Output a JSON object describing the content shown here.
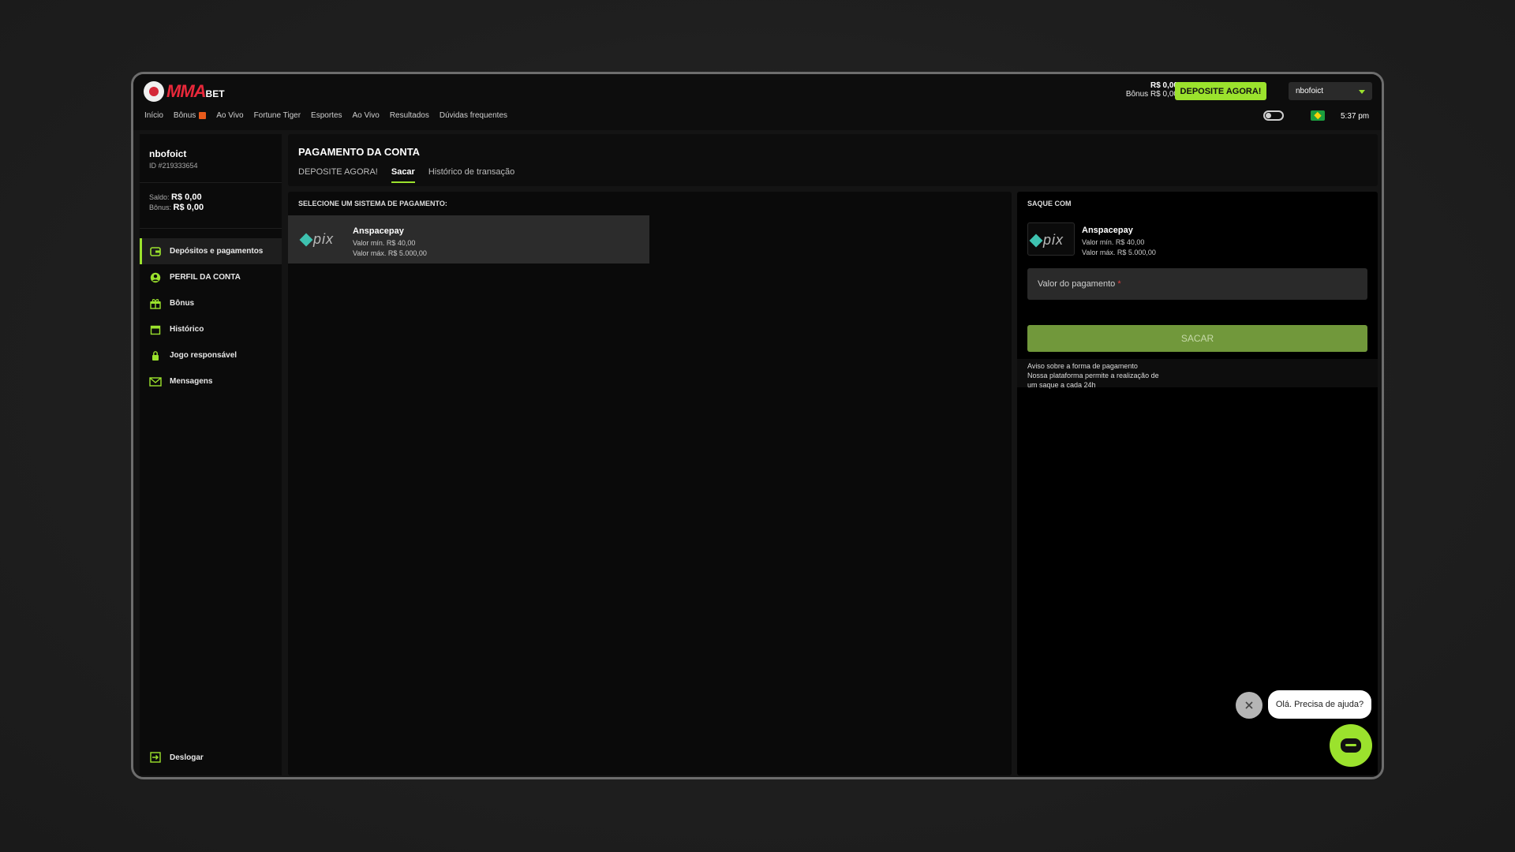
{
  "brand": {
    "name": "MMA",
    "suffix": "BET"
  },
  "nav": [
    "Início",
    "Bônus",
    "Ao Vivo",
    "Fortune Tiger",
    "Esportes",
    "Ao Vivo",
    "Resultados",
    "Dúvidas frequentes"
  ],
  "header": {
    "balance": "R$ 0,00",
    "bonus": "Bônus R$ 0,00",
    "deposit_label": "DEPOSITE AGORA!",
    "username": "nbofoict",
    "time": "5:37 pm"
  },
  "sidebar": {
    "name": "nbofoict",
    "id": "ID #219333654",
    "saldo_label": "Saldo:",
    "saldo": "R$ 0,00",
    "bonus_label": "Bônus:",
    "bonus": "R$ 0,00",
    "items": [
      {
        "label": "Depósitos e pagamentos",
        "icon": "wallet-icon"
      },
      {
        "label": "PERFIL DA CONTA",
        "icon": "user-icon"
      },
      {
        "label": "Bônus",
        "icon": "gift-icon"
      },
      {
        "label": "Histórico",
        "icon": "calendar-icon"
      },
      {
        "label": "Jogo responsável",
        "icon": "lock-icon"
      },
      {
        "label": "Mensagens",
        "icon": "mail-icon"
      }
    ],
    "logout": "Deslogar"
  },
  "content": {
    "title": "PAGAMENTO DA CONTA",
    "tabs": [
      "DEPOSITE AGORA!",
      "Sacar",
      "Histórico de transação"
    ],
    "active_tab": "Sacar",
    "select_label": "SELECIONE UM SISTEMA DE PAGAMENTO:"
  },
  "method": {
    "name": "Anspacepay",
    "min": "Valor mín.  R$ 40,00",
    "max": "Valor máx.  R$ 5.000,00",
    "logo_text": "pix"
  },
  "saque": {
    "label": "SAQUE COM",
    "amount_label": "Valor do pagamento",
    "required_mark": "*",
    "button": "SACAR",
    "notice_lines": [
      "Aviso sobre a forma de pagamento",
      "Nossa plataforma permite a realização de",
      "um saque a cada 24h"
    ]
  },
  "chat": {
    "greeting": "Olá. Precisa de ajuda?"
  },
  "colors": {
    "accent": "#9be22d",
    "brand": "#e8283a",
    "button_disabled": "#71983b"
  }
}
